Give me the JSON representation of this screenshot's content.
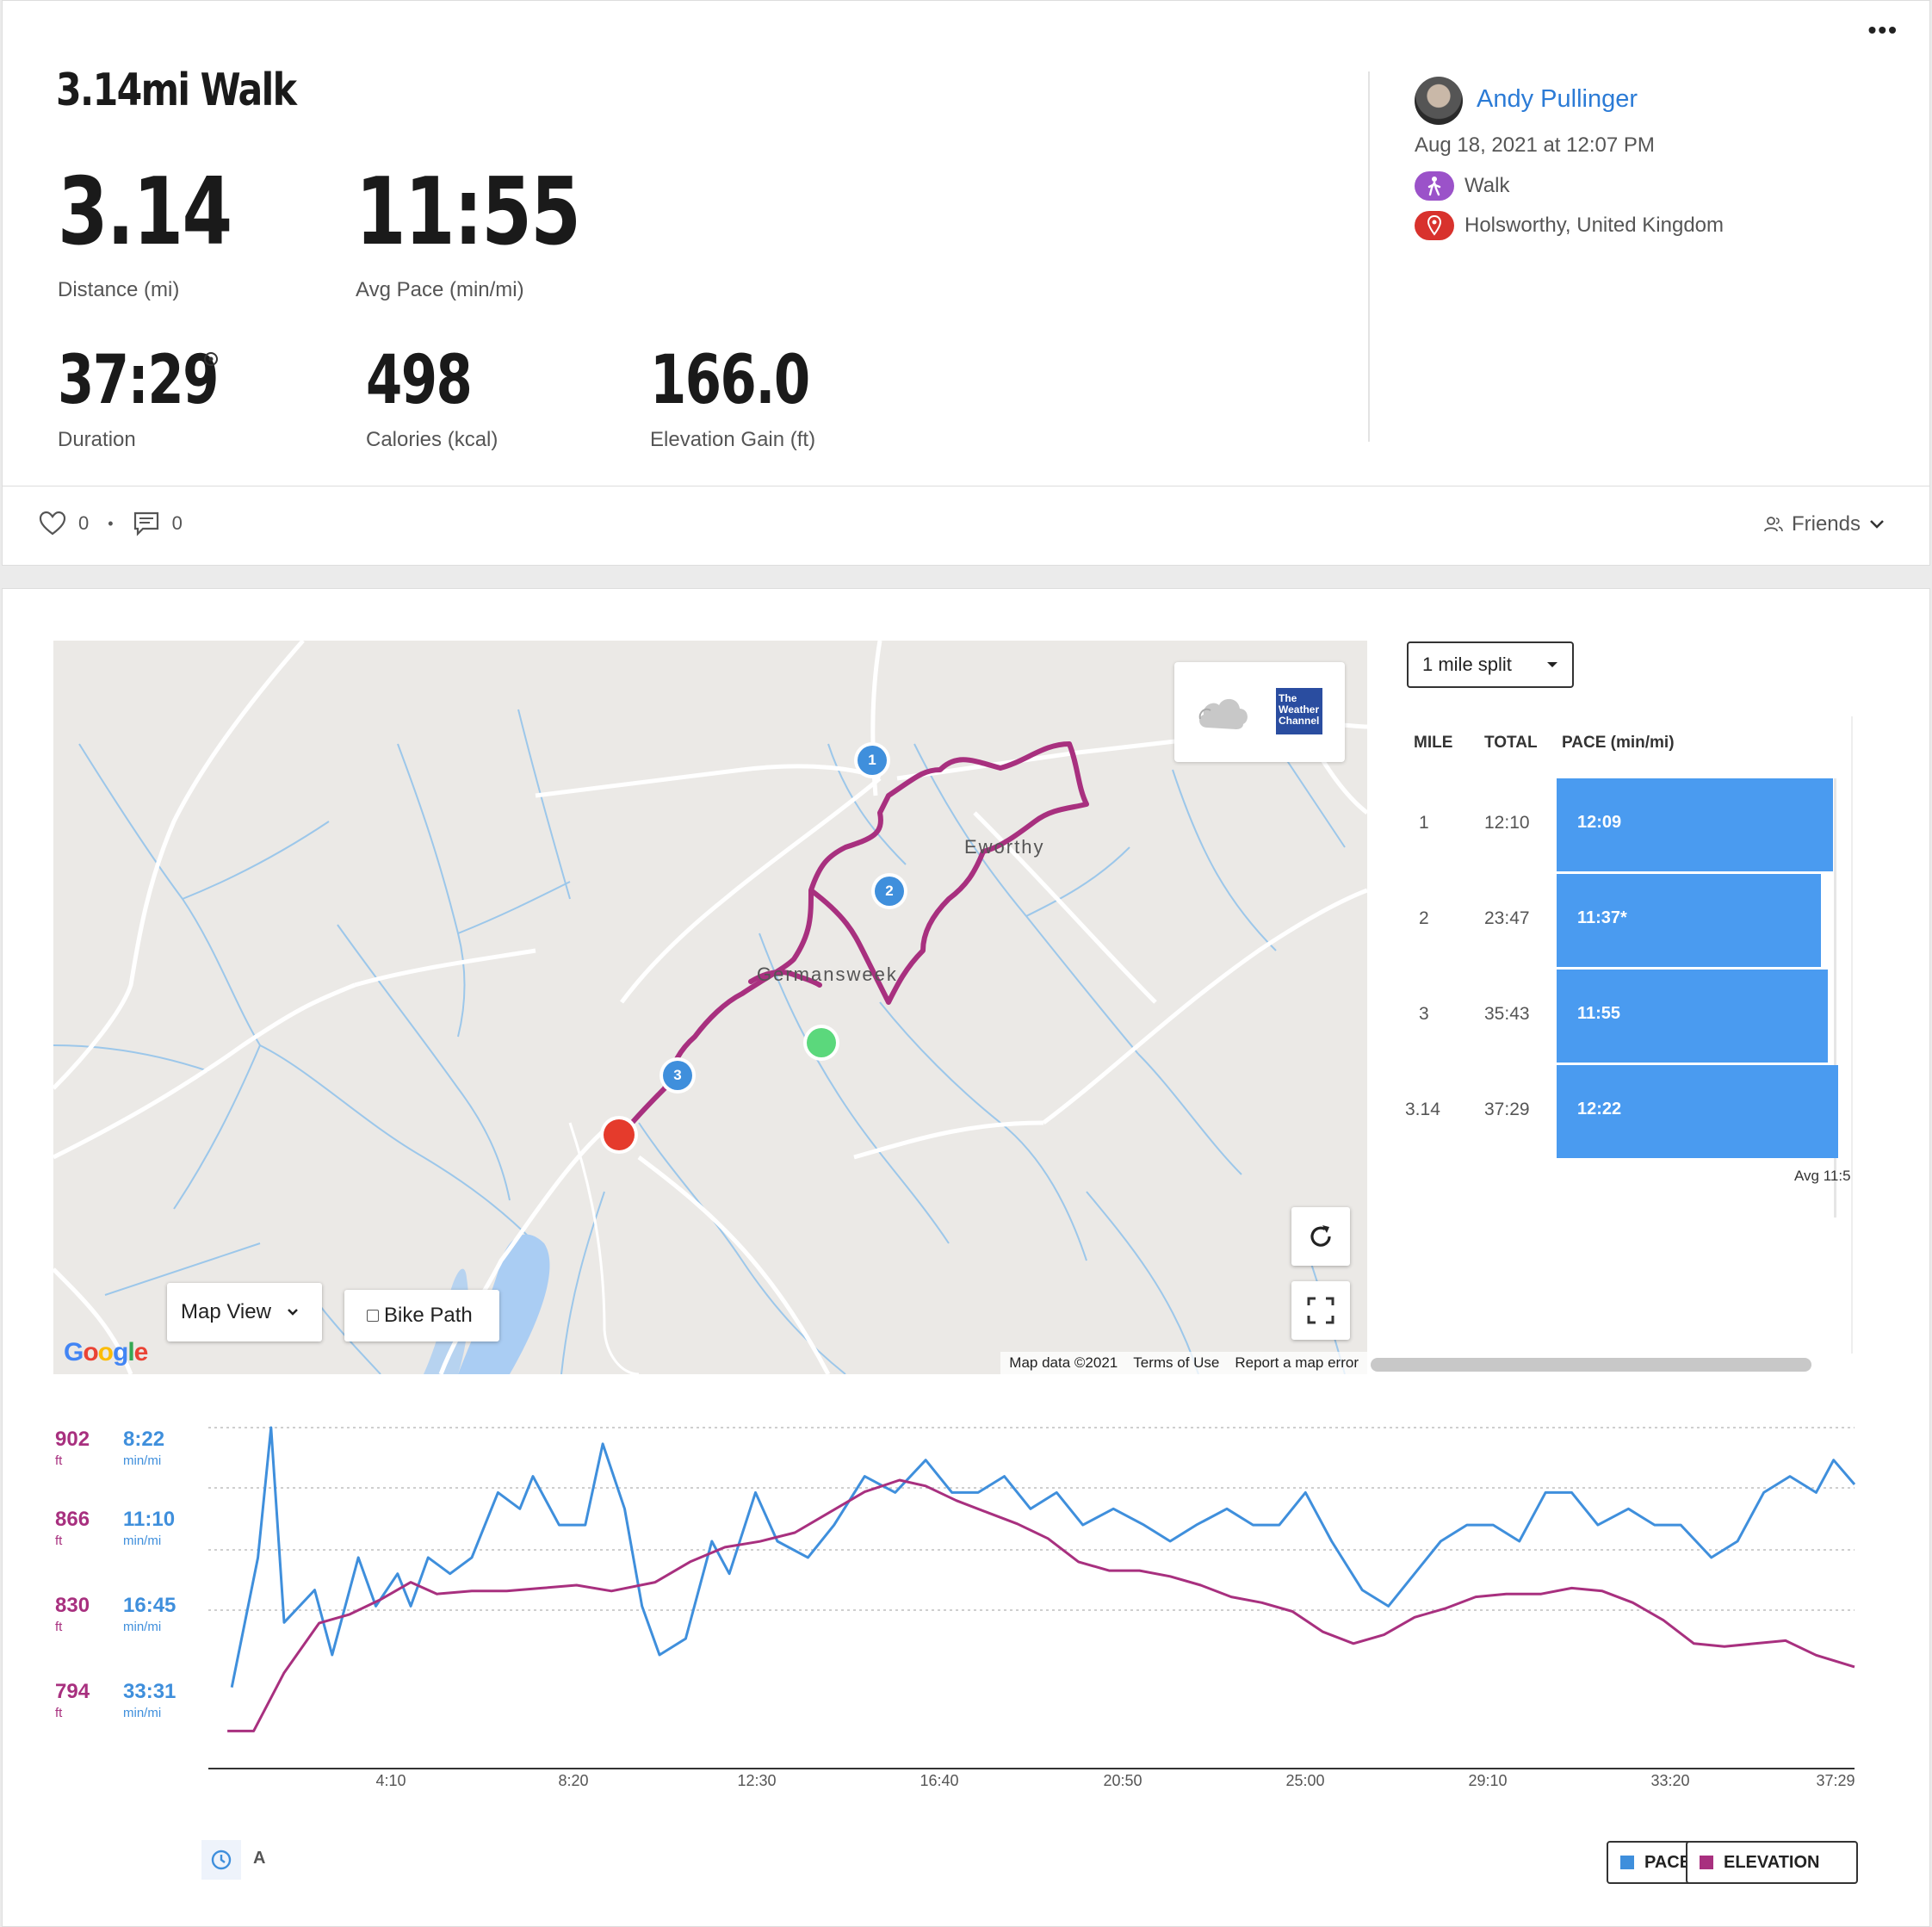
{
  "header": {
    "title": "3.14mi Walk",
    "more": "•••"
  },
  "stats": {
    "distance": {
      "value": "3.14",
      "label": "Distance (mi)"
    },
    "avg_pace": {
      "value": "11:55",
      "label": "Avg Pace (min/mi)"
    },
    "duration": {
      "value": "37:29",
      "label": "Duration"
    },
    "calories": {
      "value": "498",
      "label": "Calories (kcal)"
    },
    "elevation": {
      "value": "166.0",
      "label": "Elevation Gain (ft)"
    }
  },
  "user": {
    "name": "Andy Pullinger",
    "date": "Aug 18, 2021 at 12:07 PM",
    "activity_type": "Walk",
    "location": "Holsworthy, United Kingdom"
  },
  "social": {
    "likes": "0",
    "comments": "0",
    "privacy": "Friends"
  },
  "map": {
    "view_select": "Map View",
    "bike_path": "Bike Path",
    "towns": [
      "Eworthy",
      "Germansweek"
    ],
    "markers": [
      "1",
      "2",
      "3"
    ],
    "attribution": [
      "Map data ©2021",
      "Terms of Use",
      "Report a map error"
    ],
    "google": "Google",
    "weather": "The Weather Channel"
  },
  "splits": {
    "select": "1 mile split",
    "headers": [
      "MILE",
      "TOTAL",
      "PACE (min/mi)"
    ],
    "rows": [
      {
        "mile": "1",
        "total": "12:10",
        "pace": "12:09",
        "pace_min": 12.15
      },
      {
        "mile": "2",
        "total": "23:47",
        "pace": "11:37*",
        "pace_min": 11.62
      },
      {
        "mile": "3",
        "total": "35:43",
        "pace": "11:55",
        "pace_min": 11.92
      },
      {
        "mile": "3.14",
        "total": "37:29",
        "pace": "12:22",
        "pace_min": 12.37
      }
    ],
    "avg_label": "Avg 11:5"
  },
  "chart_data": {
    "type": "line",
    "elevation_ticks": [
      {
        "value": "902",
        "unit": "ft"
      },
      {
        "value": "866",
        "unit": "ft"
      },
      {
        "value": "830",
        "unit": "ft"
      },
      {
        "value": "794",
        "unit": "ft"
      }
    ],
    "pace_ticks": [
      {
        "value": "8:22",
        "unit": "min/mi"
      },
      {
        "value": "11:10",
        "unit": "min/mi"
      },
      {
        "value": "16:45",
        "unit": "min/mi"
      },
      {
        "value": "33:31",
        "unit": "min/mi"
      }
    ],
    "x_ticks": [
      "4:10",
      "8:20",
      "12:30",
      "16:40",
      "20:50",
      "25:00",
      "29:10",
      "33:20",
      "37:29"
    ],
    "x_range_min": [
      0,
      37.48
    ],
    "elevation_range": [
      794,
      902
    ],
    "series": [
      {
        "name": "PACE",
        "color": "#3f8fdc",
        "points": [
          [
            0.3,
            10
          ],
          [
            0.9,
            26
          ],
          [
            1.2,
            42
          ],
          [
            1.5,
            18
          ],
          [
            2.2,
            22
          ],
          [
            2.6,
            14
          ],
          [
            3.2,
            26
          ],
          [
            3.6,
            20
          ],
          [
            4.1,
            24
          ],
          [
            4.4,
            20
          ],
          [
            4.8,
            26
          ],
          [
            5.3,
            24
          ],
          [
            5.8,
            26
          ],
          [
            6.4,
            34
          ],
          [
            6.9,
            32
          ],
          [
            7.2,
            36
          ],
          [
            7.8,
            30
          ],
          [
            8.4,
            30
          ],
          [
            8.8,
            40
          ],
          [
            9.3,
            32
          ],
          [
            9.7,
            20
          ],
          [
            10.1,
            14
          ],
          [
            10.7,
            16
          ],
          [
            11.3,
            28
          ],
          [
            11.7,
            24
          ],
          [
            12.3,
            34
          ],
          [
            12.8,
            28
          ],
          [
            13.5,
            26
          ],
          [
            14.1,
            30
          ],
          [
            14.8,
            36
          ],
          [
            15.5,
            34
          ],
          [
            16.2,
            38
          ],
          [
            16.8,
            34
          ],
          [
            17.4,
            34
          ],
          [
            18.0,
            36
          ],
          [
            18.6,
            32
          ],
          [
            19.2,
            34
          ],
          [
            19.8,
            30
          ],
          [
            20.5,
            32
          ],
          [
            21.2,
            30
          ],
          [
            21.8,
            28
          ],
          [
            22.4,
            30
          ],
          [
            23.1,
            32
          ],
          [
            23.7,
            30
          ],
          [
            24.3,
            30
          ],
          [
            24.9,
            34
          ],
          [
            25.5,
            28
          ],
          [
            26.2,
            22
          ],
          [
            26.8,
            20
          ],
          [
            27.4,
            24
          ],
          [
            28.0,
            28
          ],
          [
            28.6,
            30
          ],
          [
            29.2,
            30
          ],
          [
            29.8,
            28
          ],
          [
            30.4,
            34
          ],
          [
            31.0,
            34
          ],
          [
            31.6,
            30
          ],
          [
            32.3,
            32
          ],
          [
            32.9,
            30
          ],
          [
            33.5,
            30
          ],
          [
            34.2,
            26
          ],
          [
            34.8,
            28
          ],
          [
            35.4,
            34
          ],
          [
            36.0,
            36
          ],
          [
            36.6,
            34
          ],
          [
            37.0,
            38
          ],
          [
            37.48,
            35
          ]
        ]
      },
      {
        "name": "ELEVATION",
        "color": "#a8307f",
        "points": [
          [
            0.2,
            798
          ],
          [
            0.8,
            798
          ],
          [
            1.5,
            818
          ],
          [
            2.3,
            835
          ],
          [
            3.0,
            838
          ],
          [
            3.7,
            843
          ],
          [
            4.4,
            849
          ],
          [
            5.0,
            845
          ],
          [
            5.8,
            846
          ],
          [
            6.6,
            846
          ],
          [
            7.4,
            847
          ],
          [
            8.2,
            848
          ],
          [
            9.0,
            846
          ],
          [
            10.0,
            849
          ],
          [
            10.8,
            856
          ],
          [
            11.6,
            861
          ],
          [
            12.4,
            863
          ],
          [
            13.2,
            866
          ],
          [
            14.0,
            873
          ],
          [
            14.8,
            880
          ],
          [
            15.6,
            884
          ],
          [
            16.2,
            882
          ],
          [
            16.9,
            877
          ],
          [
            17.6,
            873
          ],
          [
            18.3,
            869
          ],
          [
            19.0,
            864
          ],
          [
            19.7,
            856
          ],
          [
            20.4,
            853
          ],
          [
            21.1,
            853
          ],
          [
            21.8,
            851
          ],
          [
            22.5,
            848
          ],
          [
            23.2,
            844
          ],
          [
            23.9,
            842
          ],
          [
            24.6,
            839
          ],
          [
            25.3,
            832
          ],
          [
            26.0,
            828
          ],
          [
            26.7,
            831
          ],
          [
            27.4,
            837
          ],
          [
            28.1,
            840
          ],
          [
            28.8,
            844
          ],
          [
            29.5,
            845
          ],
          [
            30.3,
            845
          ],
          [
            31.0,
            847
          ],
          [
            31.7,
            846
          ],
          [
            32.4,
            842
          ],
          [
            33.1,
            836
          ],
          [
            33.8,
            828
          ],
          [
            34.5,
            827
          ],
          [
            35.2,
            828
          ],
          [
            35.9,
            829
          ],
          [
            36.6,
            824
          ],
          [
            37.48,
            820
          ]
        ]
      }
    ],
    "legend": [
      "PACE",
      "ELEVATION"
    ],
    "toggle_distance": "A"
  }
}
